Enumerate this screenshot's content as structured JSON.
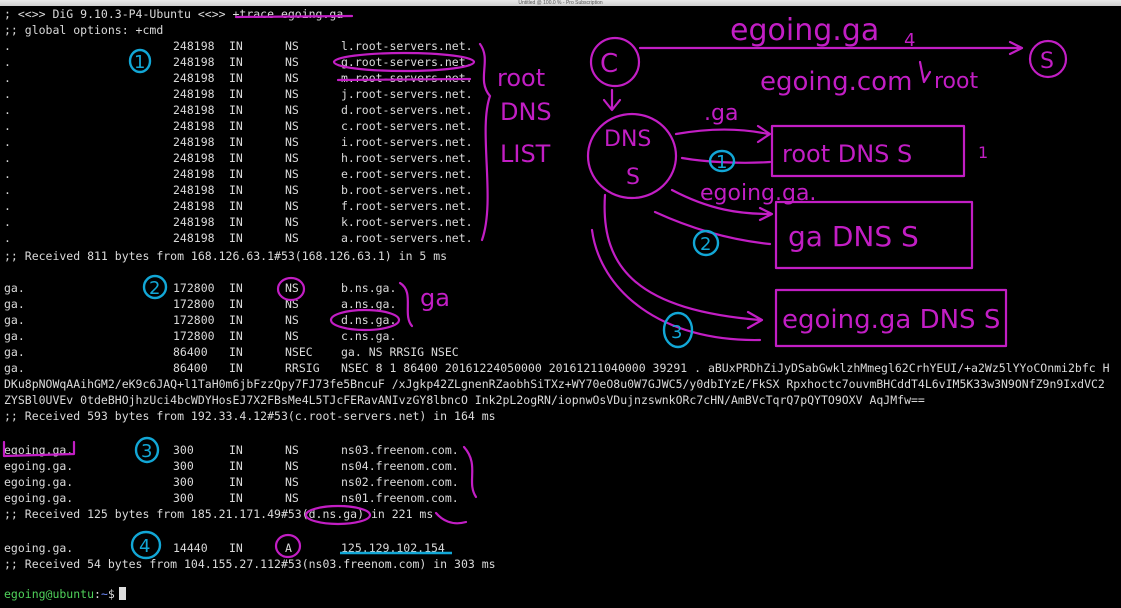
{
  "window": {
    "title": "Untitled @ 100.0 % - Pro Subscription"
  },
  "header": {
    "dig_banner": "; <<>> DiG 9.10.3-P4-Ubuntu <<>> +trace egoing.ga",
    "global_options": ";; global options: +cmd"
  },
  "root_records": [
    [
      ".",
      "248198",
      "IN",
      "NS",
      "l.root-servers.net."
    ],
    [
      ".",
      "248198",
      "IN",
      "NS",
      "g.root-servers.net."
    ],
    [
      ".",
      "248198",
      "IN",
      "NS",
      "m.root-servers.net."
    ],
    [
      ".",
      "248198",
      "IN",
      "NS",
      "j.root-servers.net."
    ],
    [
      ".",
      "248198",
      "IN",
      "NS",
      "d.root-servers.net."
    ],
    [
      ".",
      "248198",
      "IN",
      "NS",
      "c.root-servers.net."
    ],
    [
      ".",
      "248198",
      "IN",
      "NS",
      "i.root-servers.net."
    ],
    [
      ".",
      "248198",
      "IN",
      "NS",
      "h.root-servers.net."
    ],
    [
      ".",
      "248198",
      "IN",
      "NS",
      "e.root-servers.net."
    ],
    [
      ".",
      "248198",
      "IN",
      "NS",
      "b.root-servers.net."
    ],
    [
      ".",
      "248198",
      "IN",
      "NS",
      "f.root-servers.net."
    ],
    [
      ".",
      "248198",
      "IN",
      "NS",
      "k.root-servers.net."
    ],
    [
      ".",
      "248198",
      "IN",
      "NS",
      "a.root-servers.net."
    ]
  ],
  "received_1": ";; Received 811 bytes from 168.126.63.1#53(168.126.63.1) in 5 ms",
  "ga_records": [
    [
      "ga.",
      "172800",
      "IN",
      "NS",
      "b.ns.ga."
    ],
    [
      "ga.",
      "172800",
      "IN",
      "NS",
      "a.ns.ga."
    ],
    [
      "ga.",
      "172800",
      "IN",
      "NS",
      "d.ns.ga."
    ],
    [
      "ga.",
      "172800",
      "IN",
      "NS",
      "c.ns.ga."
    ],
    [
      "ga.",
      "86400",
      "IN",
      "NSEC",
      "ga. NS RRSIG NSEC"
    ],
    [
      "ga.",
      "86400",
      "IN",
      "RRSIG",
      "NSEC 8 1 86400 20161224050000 20161211040000 39291 . aBUxPRDhZiJyDSabGwklzhMmegl62CrhYEUI/+a2Wz5lYYoCOnmi2bfc H"
    ]
  ],
  "rrsig_wrap": [
    "DKu8pNOWqAAihGM2/eK9c6JAQ+l1TaH0m6jbFzzQpy7FJ73fe5BncuF /xJgkp42ZLgnenRZaobhSiTXz+WY70eO8u0W7GJWC5/y0dbIYzE/FkSX Rpxhoctc7ouvmBHCddT4L6vIM5K33w3N9ONfZ9n9IxdVC2",
    "ZYSBl0UVEv 0tdeBHOjhzUci4bcWDYHosEJ7X2FBsMe4L5TJcFERavANIvzGY8lbncO Ink2pL2ogRN/iopnwOsVDujnzswnkORc7cHN/AmBVcTqrQ7pQYTO9OXV AqJMfw=="
  ],
  "received_2": ";; Received 593 bytes from 192.33.4.12#53(c.root-servers.net) in 164 ms",
  "egoing_records": [
    [
      "egoing.ga.",
      "300",
      "IN",
      "NS",
      "ns03.freenom.com."
    ],
    [
      "egoing.ga.",
      "300",
      "IN",
      "NS",
      "ns04.freenom.com."
    ],
    [
      "egoing.ga.",
      "300",
      "IN",
      "NS",
      "ns02.freenom.com."
    ],
    [
      "egoing.ga.",
      "300",
      "IN",
      "NS",
      "ns01.freenom.com."
    ]
  ],
  "received_3": ";; Received 125 bytes from 185.21.171.49#53(d.ns.ga) in 221 ms",
  "a_record": [
    "egoing.ga.",
    "14440",
    "IN",
    "A",
    "125.129.102.154"
  ],
  "received_4": ";; Received 54 bytes from 104.155.27.112#53(ns03.freenom.com) in 303 ms",
  "prompt": {
    "user_host": "egoing@ubuntu",
    "sep": ":",
    "path": "~",
    "symbol": "$"
  },
  "annotations": {
    "step1": "1",
    "step2": "2",
    "step3": "3",
    "step4": "4",
    "root_dns_list": [
      "root",
      "DNS",
      "LIST"
    ],
    "ga_bracket": "ga",
    "diagram": {
      "c": "C",
      "s": "S",
      "top_domain": "egoing.ga",
      "top_domain_alt": "egoing.com",
      "root_label": "root",
      "dns_server": [
        "DNS",
        "S"
      ],
      "dot_ga": ".ga",
      "root_dns_s": "root DNS S",
      "egoing_ga": "egoing.ga.",
      "ga_dns_s": "ga DNS S",
      "egoingga_dns_s": "egoing.ga DNS S",
      "n1": "1",
      "n2": "2",
      "n3": "3",
      "n4": "4"
    },
    "colors": {
      "pen_magenta": "#c21ec4",
      "pen_cyan": "#12a7d6"
    }
  }
}
